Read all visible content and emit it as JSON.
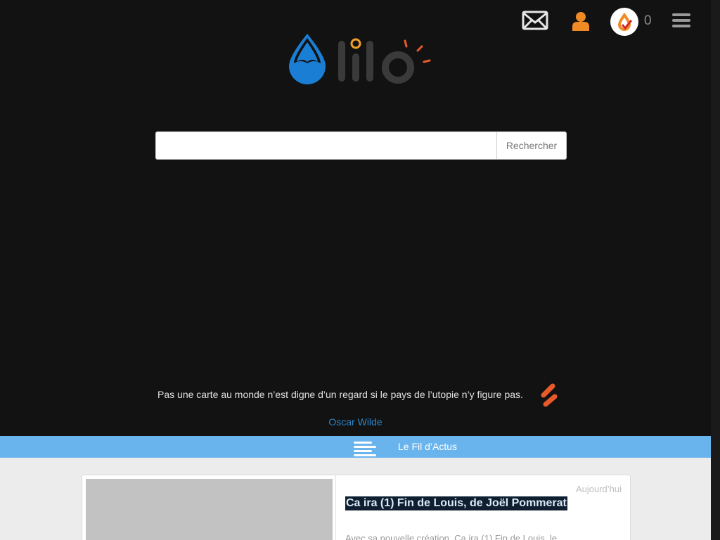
{
  "toolbar": {
    "mail_icon": "envelope-icon",
    "user_icon": "user-icon",
    "drops_icon": "water-drop-badge-icon",
    "drops_count": "0",
    "menu_icon": "hamburger-menu-icon"
  },
  "logo": {
    "alt": "lilo"
  },
  "search": {
    "value": "",
    "placeholder": "",
    "button_label": "Rechercher"
  },
  "quote": {
    "text": "Pas une carte au monde n’est digne d’un regard si le pays de l’utopie n’y figure pas.",
    "author": "Oscar Wilde"
  },
  "news": {
    "label": "Le Fil d’Actus",
    "article": {
      "date": "Aujourd’hui",
      "title": "Ca ira (1) Fin de Louis, de Joël Pommerat",
      "excerpt": "Avec sa nouvelle création, Ca ira (1) Fin de Louis, le"
    }
  },
  "colors": {
    "background": "#121212",
    "accent_blue": "#6ab4ee",
    "accent_orange": "#f08a24",
    "link_blue": "#2f86c9"
  }
}
